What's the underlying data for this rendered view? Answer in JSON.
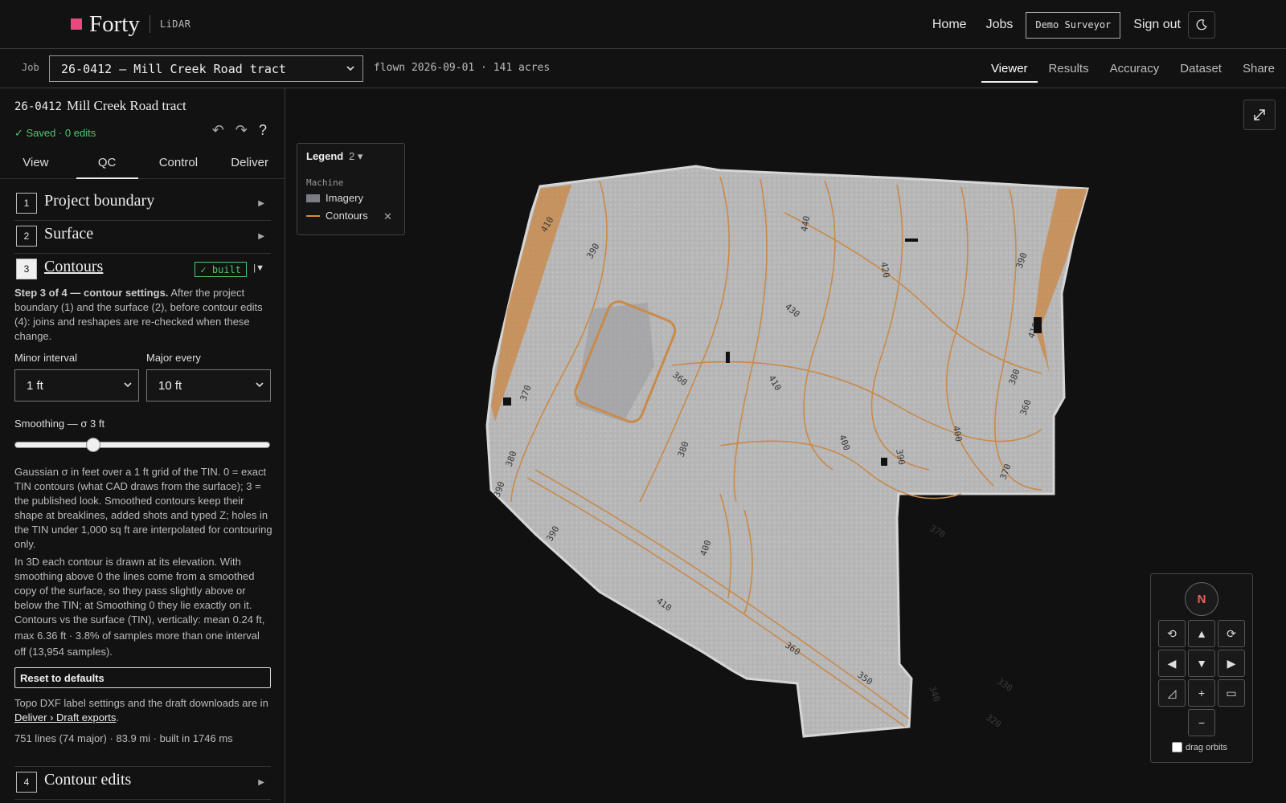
{
  "topbar": {
    "brand": "Forty",
    "brand_sub": "LiDAR",
    "nav": [
      "Home",
      "Jobs"
    ],
    "user": "Demo Surveyor",
    "signout": "Sign out"
  },
  "jobbar": {
    "label": "Job",
    "job": "26-0412 — Mill Creek Road tract",
    "meta": "flown 2026-09-01 · 141 acres",
    "tabs": [
      "Viewer",
      "Results",
      "Accuracy",
      "Dataset",
      "Share"
    ],
    "active_tab": "Viewer"
  },
  "panel": {
    "job_id": "26-0412",
    "job_name": "Mill Creek Road tract",
    "saved": "✓ Saved · 0 edits",
    "tabs": [
      "View",
      "QC",
      "Control",
      "Deliver"
    ],
    "active_tab": "QC",
    "sections": [
      {
        "num": "1",
        "title": "Project boundary"
      },
      {
        "num": "2",
        "title": "Surface"
      },
      {
        "num": "3",
        "title": "Contours",
        "badge": "✓ built"
      },
      {
        "num": "4",
        "title": "Contour edits"
      }
    ],
    "step_bold": "Step 3 of 4 — contour settings.",
    "step_text": " After the project boundary (1) and the surface (2), before contour edits (4): joins and reshapes are re-checked when these change.",
    "minor_label": "Minor interval",
    "minor_value": "1 ft",
    "major_label": "Major every",
    "major_value": "10 ft",
    "smoothing_label": "Smoothing — σ 3 ft",
    "smoothing_value": 3,
    "help1": "Gaussian σ in feet over a 1 ft grid of the TIN. 0 = exact TIN contours (what CAD draws from the surface); 3 = the published look. Smoothed contours keep their shape at breaklines, added shots and typed Z; holes in the TIN under 1,000 sq ft are interpolated for contouring only.",
    "help2": "In 3D each contour is drawn at its elevation. With smoothing above 0 the lines come from a smoothed copy of the surface, so they pass slightly above or below the TIN; at Smoothing 0 they lie exactly on it.",
    "help3": "Contours vs the surface (TIN), vertically: mean 0.24 ft, max 6.36 ft · 3.8% of samples more than one interval off (13,954 samples).",
    "reset": "Reset to defaults",
    "deliver_pre": "Topo DXF label settings and the draft downloads are in ",
    "deliver_link": "Deliver › Draft exports",
    "deliver_post": ".",
    "stats": "751 lines (74 major) · 83.9 mi · built in 1746 ms"
  },
  "legend": {
    "title": "Legend",
    "count": "2",
    "group": "Machine",
    "items": [
      "Imagery",
      "Contours"
    ],
    "imagery_color": "#7a7d84",
    "contour_color": "#d98a3a"
  },
  "map": {
    "contour_labels": [
      "410",
      "390",
      "370",
      "360",
      "380",
      "400",
      "410",
      "430",
      "440",
      "420",
      "400",
      "390",
      "380",
      "370",
      "360",
      "350",
      "340",
      "330",
      "320",
      "410",
      "400",
      "390",
      "370",
      "410",
      "360",
      "390",
      "390",
      "380"
    ]
  },
  "navpad": {
    "north": "N",
    "drag_orbits": "drag orbits"
  }
}
